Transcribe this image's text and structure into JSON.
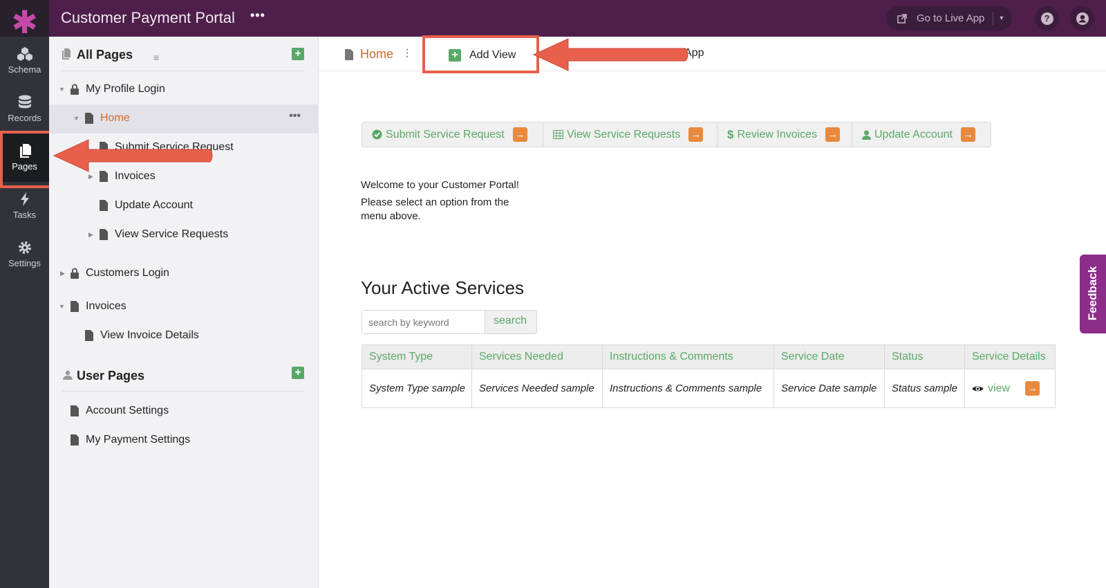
{
  "app": {
    "title": "Customer Payment Portal",
    "more": "•••"
  },
  "topbar": {
    "live_label": "Go to Live App",
    "help": "?",
    "caret": "▾"
  },
  "nav": {
    "items": [
      {
        "label": "Schema"
      },
      {
        "label": "Records"
      },
      {
        "label": "Pages"
      },
      {
        "label": "Tasks"
      },
      {
        "label": "Settings"
      }
    ]
  },
  "tree": {
    "all_pages_title": "All Pages",
    "filter": "≡",
    "add": "+",
    "rows": [
      {
        "label": "My Profile Login"
      },
      {
        "label": "Home"
      },
      {
        "label": "Submit Service Request"
      },
      {
        "label": "Invoices"
      },
      {
        "label": "Update Account"
      },
      {
        "label": "View Service Requests"
      },
      {
        "label": "Customers Login"
      },
      {
        "label": "Invoices"
      },
      {
        "label": "View Invoice Details"
      }
    ],
    "row_more": "•••",
    "user_pages_title": "User Pages",
    "user_rows": [
      {
        "label": "Account Settings"
      },
      {
        "label": "My Payment Settings"
      }
    ]
  },
  "tabs": {
    "home": "Home",
    "vdots": "⋮",
    "add_view": "Add View",
    "tail": "App"
  },
  "menu": {
    "items": [
      {
        "label": "Submit Service Request",
        "icon": "check-circle-icon"
      },
      {
        "label": "View Service Requests",
        "icon": "table-icon"
      },
      {
        "label": "Review Invoices",
        "icon": "dollar-icon"
      },
      {
        "label": "Update Account",
        "icon": "user-icon"
      }
    ],
    "arrow": "→"
  },
  "welcome": {
    "line1": "Welcome to your Customer Portal!",
    "line2": "Please select an option from the menu above."
  },
  "services": {
    "title": "Your Active Services",
    "search_placeholder": "search by keyword",
    "search_button": "search",
    "columns": [
      "System Type",
      "Services Needed",
      "Instructions & Comments",
      "Service Date",
      "Status",
      "Service Details"
    ],
    "row": [
      "System Type sample",
      "Services Needed sample",
      "Instructions & Comments sample",
      "Service Date sample",
      "Status sample"
    ],
    "view_link": "view"
  },
  "feedback": "Feedback",
  "colors": {
    "brand": "#4e1f4b",
    "accent_green": "#5aa868",
    "accent_orange": "#e8893d",
    "highlight_red": "#e8604c"
  }
}
